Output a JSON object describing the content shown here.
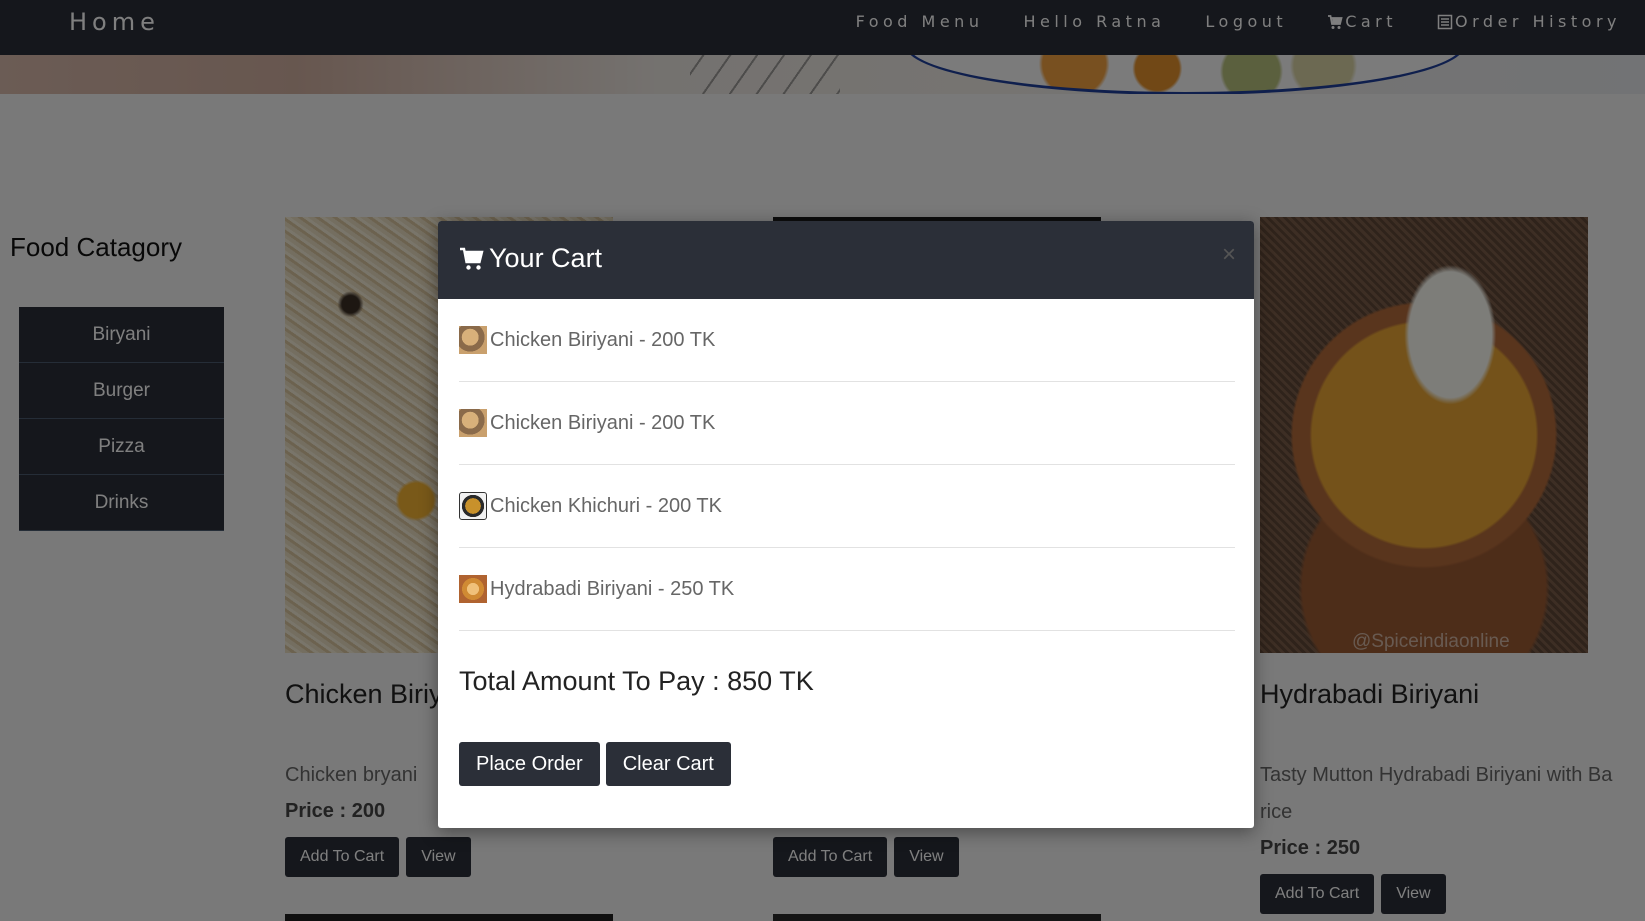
{
  "nav": {
    "brand": "Home",
    "links": [
      "Food Menu",
      "Hello Ratna",
      "Logout",
      "Cart",
      "Order History"
    ],
    "icons": {
      "cart": "cart-icon",
      "history": "list-icon"
    }
  },
  "sidebar": {
    "title": "Food Catagory",
    "categories": [
      "Biryani",
      "Burger",
      "Pizza",
      "Drinks"
    ]
  },
  "cards": [
    {
      "title": "Chicken Biriyani",
      "desc": "Chicken bryani",
      "price": "Price : 200",
      "add": "Add To Cart",
      "view": "View"
    },
    {
      "add": "Add To Cart",
      "view": "View"
    },
    {
      "title": "Hydrabadi Biriyani",
      "desc_line1": "Tasty Mutton Hydrabadi Biriyani with Ba",
      "desc_line2": "rice",
      "price": "Price : 250",
      "add": "Add To Cart",
      "view": "View",
      "watermark": "@Spiceindiaonline"
    }
  ],
  "modal": {
    "title": "Your Cart",
    "close": "×",
    "items": [
      "Chicken Biriyani - 200 TK",
      "Chicken Biriyani - 200 TK",
      "Chicken Khichuri - 200 TK",
      "Hydrabadi Biriyani - 250 TK"
    ],
    "total": "Total Amount To Pay : 850 TK",
    "place_order": "Place Order",
    "clear_cart": "Clear Cart"
  },
  "colors": {
    "dark": "#2b2f38",
    "overlay": "rgba(0,0,0,0.5)"
  }
}
